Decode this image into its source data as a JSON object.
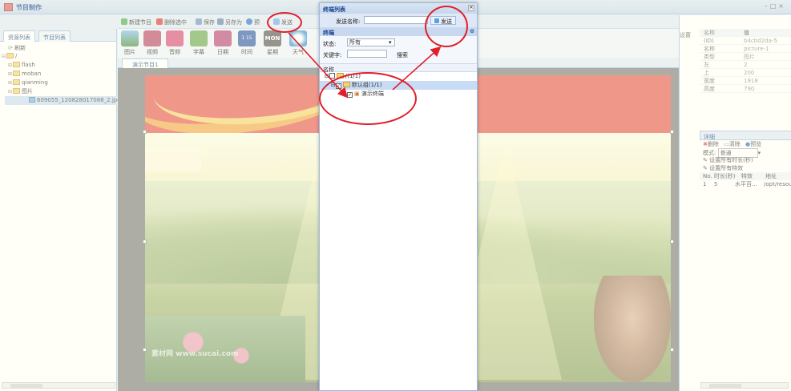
{
  "window": {
    "title": "节目制作"
  },
  "left_panel": {
    "tabs": [
      "资源列表",
      "节目列表"
    ],
    "refresh_label": "刷新",
    "tree": {
      "root": "/",
      "items": [
        "flash",
        "moban",
        "qianming",
        "图片"
      ],
      "file": "609055_120828017088_2.jpg"
    }
  },
  "toolbar": {
    "buttons": [
      "新建节目",
      "删除选中",
      "保存",
      "另存为",
      "预",
      "发送"
    ]
  },
  "media_toolbar": {
    "items": [
      "图片",
      "视频",
      "音频",
      "字幕",
      "日期",
      "时间",
      "星期",
      "天气"
    ],
    "date_text": "1 15",
    "week_text": "MON"
  },
  "doc_tab": {
    "label": "演示节目1"
  },
  "canvas": {
    "watermark": "素材网 www.sucai.com"
  },
  "right_panel": {
    "settings_label": "设置",
    "properties": {
      "headers": [
        "名称",
        "值"
      ],
      "rows": [
        {
          "k": "(ID)",
          "v": "b4cbd2da-5"
        },
        {
          "k": "名称",
          "v": "picture-1"
        },
        {
          "k": "类型",
          "v": "图片"
        },
        {
          "k": "左",
          "v": "2"
        },
        {
          "k": "上",
          "v": "200"
        },
        {
          "k": "宽度",
          "v": "1918"
        },
        {
          "k": "高度",
          "v": "790"
        }
      ]
    },
    "detail": {
      "title": "详细",
      "actions": [
        "删除",
        "清除",
        "预览"
      ],
      "mode_label": "模式:",
      "mode_value": "普通",
      "set_duration": "设置所有时长(秒)",
      "set_effect": "设置所有特效",
      "table_headers": [
        "No.",
        "时长(秒)",
        "特效",
        "地址"
      ],
      "table_rows": [
        {
          "no": "1",
          "dur": "5",
          "effect": "水平百...",
          "addr": "/opt/resou"
        }
      ]
    }
  },
  "dialog": {
    "title": "终端列表",
    "send_name_label": "发送名称:",
    "send_name_value": "",
    "send_button": "发送",
    "section": "终端",
    "status_label": "状态:",
    "status_value": "所有",
    "keyword_label": "关键字:",
    "search_button": "搜索",
    "column_name": "名称",
    "tree_root": "/(1/1)",
    "tree_group": "默认组(1/1)",
    "terminal": "演示终端"
  },
  "colors": {
    "annotation": "#e0202a",
    "accent": "#15428b"
  }
}
